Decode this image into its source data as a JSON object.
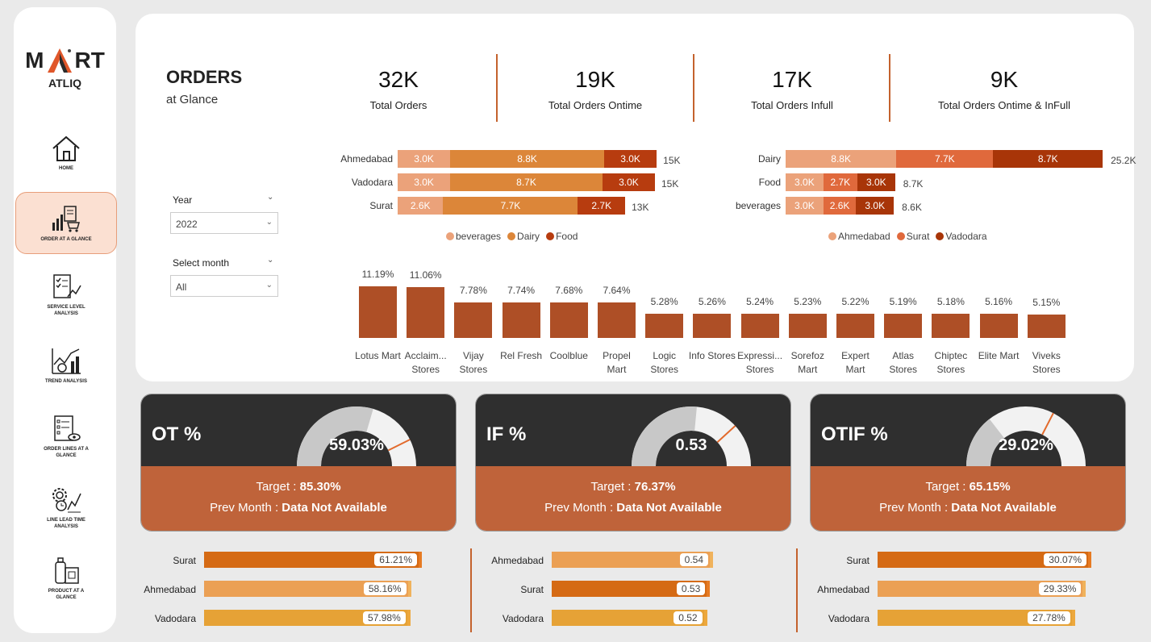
{
  "sidebar": {
    "logo_left": "M",
    "logo_right": "RT",
    "logo_sub": "ATLIQ",
    "items": [
      {
        "label": "HOME"
      },
      {
        "label": "ORDER AT A GLANCE"
      },
      {
        "label": "SERVICE LEVEL ANALYSIS"
      },
      {
        "label": "TREND ANALYSIS"
      },
      {
        "label": "ORDER LINES AT A GLANCE"
      },
      {
        "label": "LINE LEAD TIME ANALYSIS"
      },
      {
        "label": "PRODUCT AT A GLANCE"
      }
    ]
  },
  "header": {
    "title": "ORDERS",
    "subtitle": "at Glance"
  },
  "kpis": [
    {
      "value": "32K",
      "label": "Total Orders"
    },
    {
      "value": "19K",
      "label": "Total Orders Ontime"
    },
    {
      "value": "17K",
      "label": "Total Orders Infull"
    },
    {
      "value": "9K",
      "label": "Total Orders Ontime & InFull"
    }
  ],
  "filters": {
    "year_label": "Year",
    "year_value": "2022",
    "month_label": "Select month",
    "month_value": "All"
  },
  "colors": {
    "accent": "#c4622d",
    "beverages": "#eba27a",
    "dairy": "#dc8639",
    "food": "#b73c0f",
    "ahmedabad": "#eba27a",
    "surat": "#e0693c",
    "vadodara": "#a83508",
    "column": "#ae4f26"
  },
  "chart_data": [
    {
      "type": "bar",
      "orientation": "horizontal-stacked",
      "categories": [
        "Ahmedabad",
        "Vadodara",
        "Surat"
      ],
      "series": [
        {
          "name": "beverages",
          "values": [
            3.0,
            3.0,
            2.6
          ],
          "labels": [
            "3.0K",
            "3.0K",
            "2.6K"
          ]
        },
        {
          "name": "Dairy",
          "values": [
            8.8,
            8.7,
            7.7
          ],
          "labels": [
            "8.8K",
            "8.7K",
            "7.7K"
          ]
        },
        {
          "name": "Food",
          "values": [
            3.0,
            3.0,
            2.7
          ],
          "labels": [
            "3.0K",
            "3.0K",
            "2.7K"
          ]
        }
      ],
      "totals": [
        "15K",
        "15K",
        "13K"
      ]
    },
    {
      "type": "bar",
      "orientation": "horizontal-stacked",
      "categories": [
        "Dairy",
        "Food",
        "beverages"
      ],
      "series": [
        {
          "name": "Ahmedabad",
          "values": [
            8.8,
            3.0,
            3.0
          ],
          "labels": [
            "8.8K",
            "3.0K",
            "3.0K"
          ]
        },
        {
          "name": "Surat",
          "values": [
            7.7,
            2.7,
            2.6
          ],
          "labels": [
            "7.7K",
            "2.7K",
            "2.6K"
          ]
        },
        {
          "name": "Vadodara",
          "values": [
            8.7,
            3.0,
            3.0
          ],
          "labels": [
            "8.7K",
            "3.0K",
            "3.0K"
          ]
        }
      ],
      "totals": [
        "25.2K",
        "8.7K",
        "8.6K"
      ]
    },
    {
      "type": "bar",
      "categories": [
        "Lotus Mart",
        "Acclaim... Stores",
        "Vijay Stores",
        "Rel Fresh",
        "Coolblue",
        "Propel Mart",
        "Logic Stores",
        "Info Stores",
        "Expressi... Stores",
        "Sorefoz Mart",
        "Expert Mart",
        "Atlas Stores",
        "Chiptec Stores",
        "Elite Mart",
        "Viveks Stores"
      ],
      "values": [
        11.19,
        11.06,
        7.78,
        7.74,
        7.68,
        7.64,
        5.28,
        5.26,
        5.24,
        5.23,
        5.22,
        5.19,
        5.18,
        5.16,
        5.15
      ],
      "labels": [
        "11.19%",
        "11.06%",
        "7.78%",
        "7.74%",
        "7.68%",
        "7.64%",
        "5.28%",
        "5.26%",
        "5.24%",
        "5.23%",
        "5.22%",
        "5.19%",
        "5.18%",
        "5.16%",
        "5.15%"
      ]
    },
    {
      "type": "bar",
      "orientation": "horizontal",
      "categories": [
        "Surat",
        "Ahmedabad",
        "Vadodara"
      ],
      "values": [
        61.21,
        58.16,
        57.98
      ],
      "labels": [
        "61.21%",
        "58.16%",
        "57.98%"
      ]
    },
    {
      "type": "bar",
      "orientation": "horizontal",
      "categories": [
        "Ahmedabad",
        "Surat",
        "Vadodara"
      ],
      "values": [
        0.54,
        0.53,
        0.52
      ],
      "labels": [
        "0.54",
        "0.53",
        "0.52"
      ]
    },
    {
      "type": "bar",
      "orientation": "horizontal",
      "categories": [
        "Surat",
        "Ahmedabad",
        "Vadodara"
      ],
      "values": [
        30.07,
        29.33,
        27.78
      ],
      "labels": [
        "30.07%",
        "29.33%",
        "27.78%"
      ]
    }
  ],
  "cards": [
    {
      "title": "OT %",
      "value": "59.03%",
      "fill": 0.5903,
      "target_fill": 0.853,
      "target_label": "Target : ",
      "target": "85.30%",
      "prev_label": "Prev Month : ",
      "prev": "Data Not Available"
    },
    {
      "title": "IF %",
      "value": "0.53",
      "fill": 0.53,
      "target_fill": 0.7637,
      "target_label": "Target : ",
      "target": "76.37%",
      "prev_label": "Prev Month : ",
      "prev": "Data Not Available"
    },
    {
      "title": "OTIF %",
      "value": "29.02%",
      "fill": 0.2902,
      "target_fill": 0.6515,
      "target_label": "Target : ",
      "target": "65.15%",
      "prev_label": "Prev Month : ",
      "prev": "Data Not Available"
    }
  ]
}
